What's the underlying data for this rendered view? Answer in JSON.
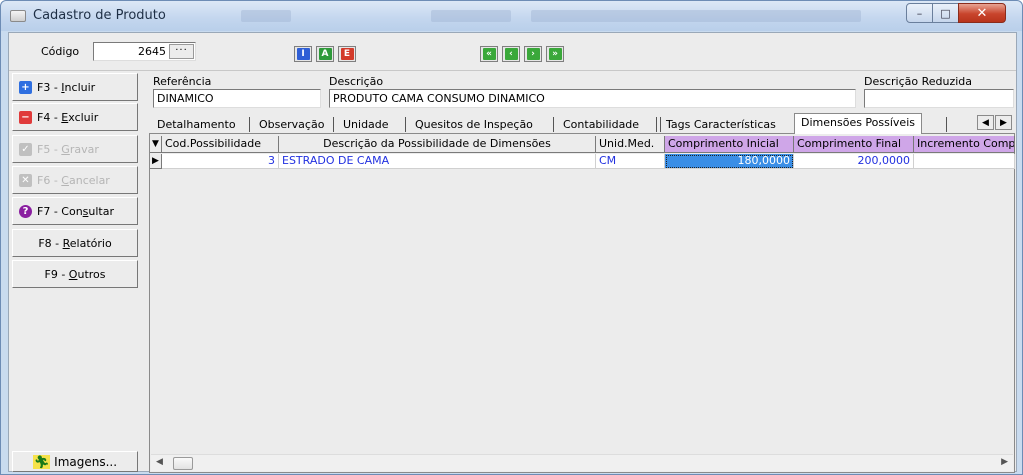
{
  "window": {
    "title": "Cadastro de Produto",
    "minimize": "–",
    "maximize": "□",
    "close": "✕"
  },
  "toolbar": {
    "codigo_label": "Código",
    "codigo_value": "2645",
    "codigo_lookup": "···",
    "mode_buttons": [
      {
        "label": "I",
        "color": "#2f5fd6"
      },
      {
        "label": "A",
        "color": "#2e9a3a"
      },
      {
        "label": "E",
        "color": "#d33a2a"
      }
    ],
    "nav_buttons": [
      "«",
      "‹",
      "›",
      "»"
    ],
    "nav_color": "#3aa83a"
  },
  "sidebar": {
    "buttons": [
      {
        "pre": "F3 - ",
        "u": "I",
        "post": "ncluir",
        "icon": "+",
        "icon_color": "#2f6fe0",
        "enabled": true
      },
      {
        "pre": "F4 - ",
        "u": "E",
        "post": "xcluir",
        "icon": "−",
        "icon_color": "#e03a3a",
        "enabled": true
      },
      {
        "pre": "F5 - ",
        "u": "G",
        "post": "ravar",
        "icon": "✓",
        "icon_color": "#c0c0c0",
        "enabled": false
      },
      {
        "pre": "F6 - ",
        "u": "C",
        "post": "ancelar",
        "icon": "✕",
        "icon_color": "#c0c0c0",
        "enabled": false
      },
      {
        "pre": "F7 - Con",
        "u": "s",
        "post": "ultar",
        "icon": "?",
        "icon_color": "#8a1fa0",
        "enabled": true
      },
      {
        "pre": "F8 - ",
        "u": "R",
        "post": "elatório",
        "icon": "",
        "icon_color": "",
        "enabled": true
      },
      {
        "pre": "F9 - ",
        "u": "O",
        "post": "utros",
        "icon": "",
        "icon_color": "",
        "enabled": true
      }
    ],
    "images_label": "Imagens..."
  },
  "form": {
    "referencia_label": "Referência",
    "referencia_value": "DINAMICO",
    "descricao_label": "Descrição",
    "descricao_value": "PRODUTO CAMA CONSUMO DINAMICO",
    "descricao_reduzida_label": "Descrição Reduzida",
    "descricao_reduzida_value": ""
  },
  "tabs": [
    "Detalhamento",
    "Observação",
    "Unidade",
    "Quesitos de Inspeção",
    "Contabilidade",
    "Tags Características",
    "Dimensões Possíveis"
  ],
  "active_tab": "Dimensões Possíveis",
  "grid": {
    "columns": [
      "Cod.Possibilidade",
      "Descrição da Possibilidade de Dimensões",
      "Unid.Med.",
      "Comprimento Inicial",
      "Comprimento Final",
      "Incremento Comp"
    ],
    "rows": [
      [
        "3",
        "ESTRADO DE CAMA",
        "CM",
        "180,0000",
        "200,0000",
        ""
      ]
    ]
  }
}
